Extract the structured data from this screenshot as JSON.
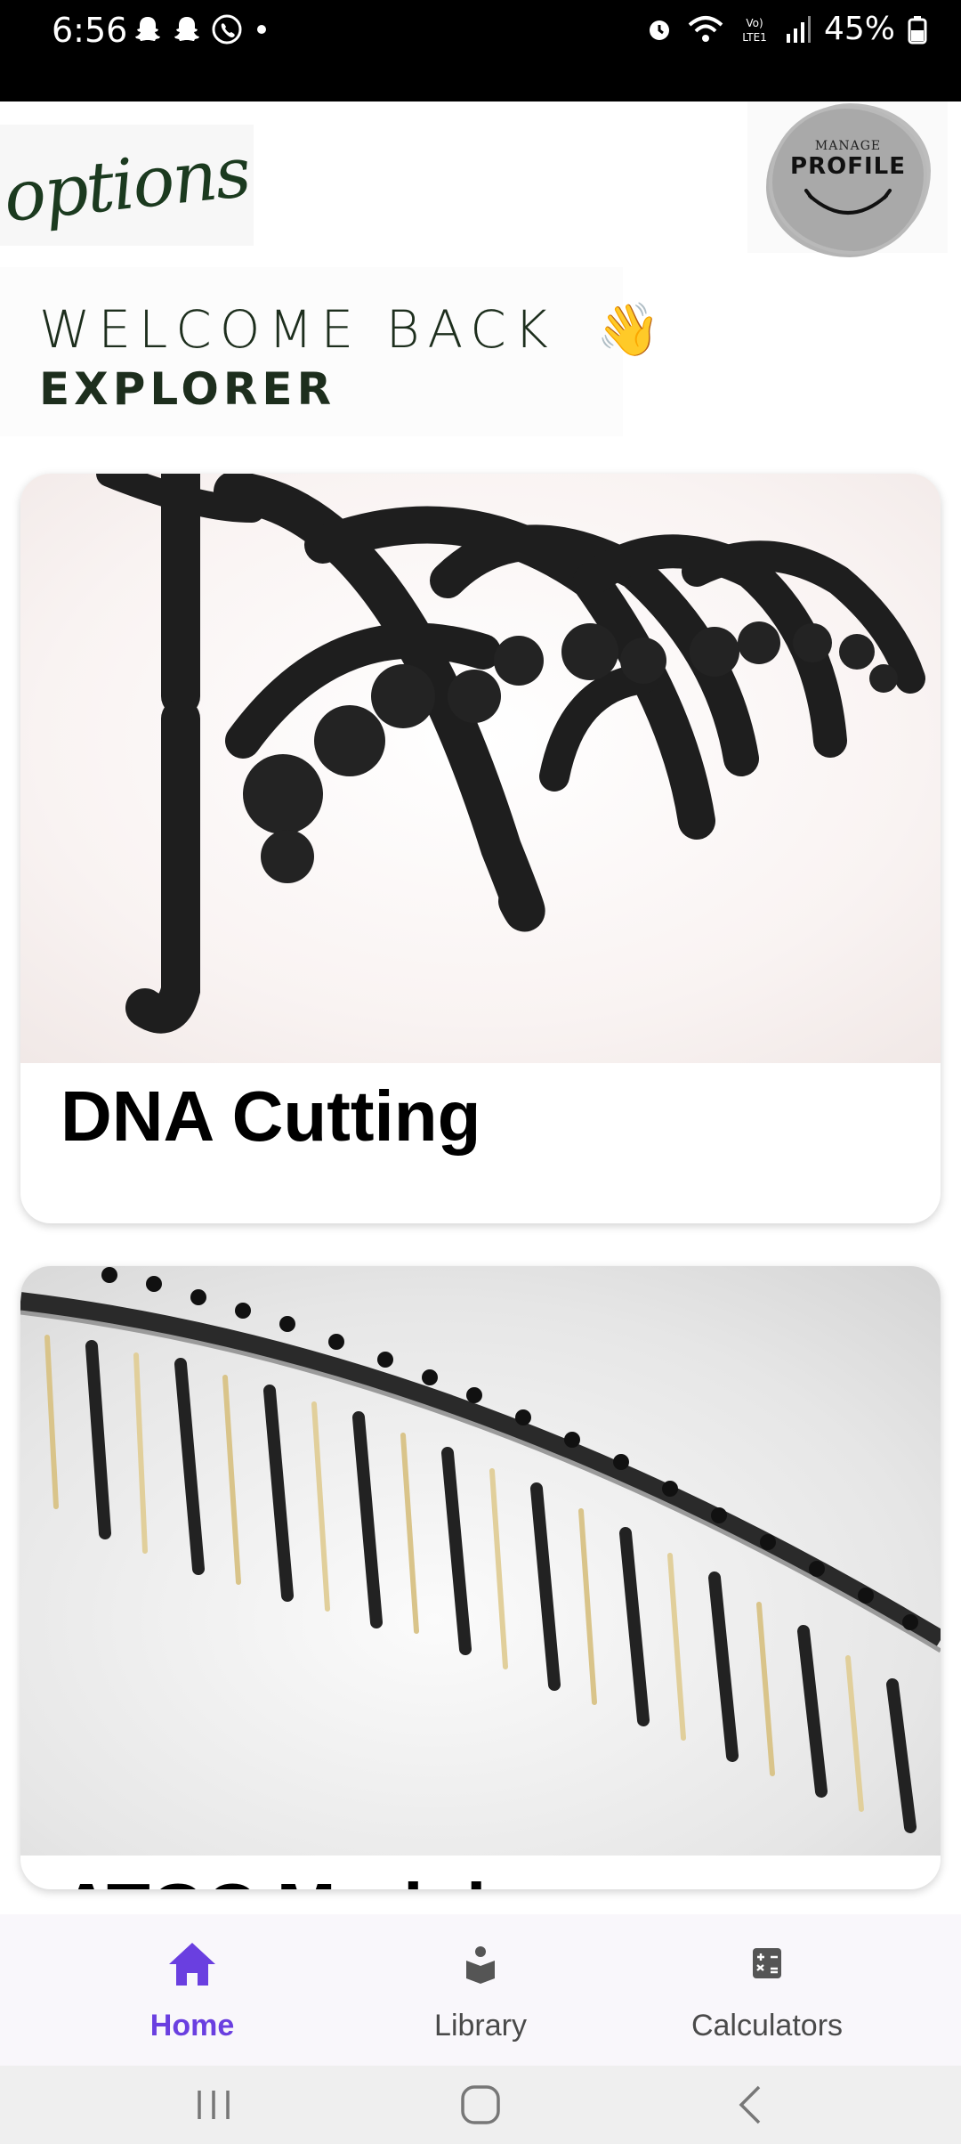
{
  "status_bar": {
    "time": "6:56",
    "battery": "45%",
    "notification_icons": [
      "snapchat-icon",
      "snapchat-icon",
      "whatsapp-icon",
      "dot-icon"
    ],
    "system_icons": [
      "alarm-icon",
      "wifi-icon",
      "volte-icon",
      "signal-icon",
      "battery-icon"
    ]
  },
  "header": {
    "logo_text": "options",
    "profile": {
      "small_text": "MANAGE",
      "big_text": "PROFILE"
    }
  },
  "welcome": {
    "line1": "WELCOME BACK",
    "line2": "EXPLORER",
    "emoji": "👋"
  },
  "cards": [
    {
      "title": "DNA Cutting",
      "image": "dna-helix-image"
    },
    {
      "title": "ATGC Module",
      "image": "comb-strand-image"
    }
  ],
  "bottom_nav": {
    "items": [
      {
        "label": "Home",
        "icon": "home-icon",
        "active": true
      },
      {
        "label": "Library",
        "icon": "library-icon",
        "active": false
      },
      {
        "label": "Calculators",
        "icon": "calculator-icon",
        "active": false
      }
    ]
  },
  "colors": {
    "accent": "#6a3fe0",
    "dark_green": "#1d2e1d",
    "status_bar": "#000000"
  }
}
